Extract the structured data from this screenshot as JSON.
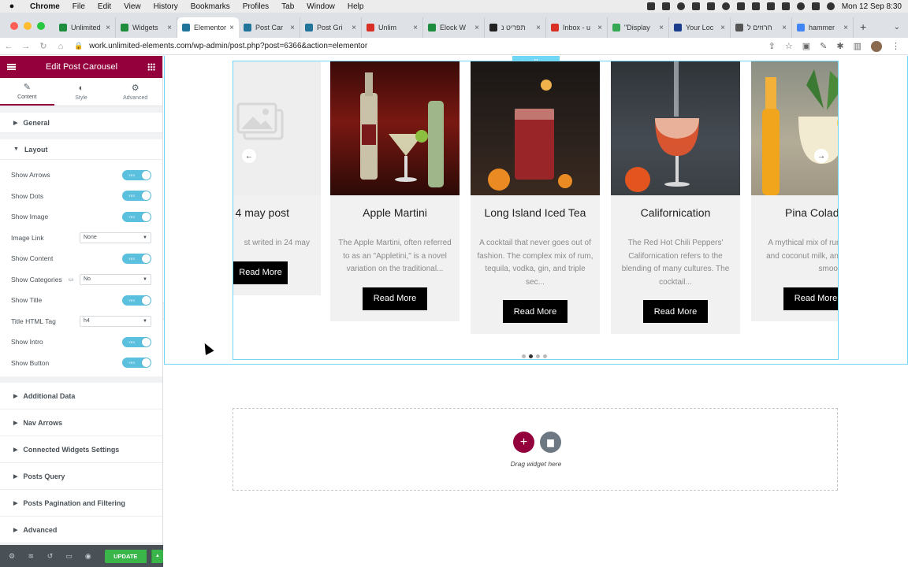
{
  "menubar": {
    "app": "Chrome",
    "items": [
      "File",
      "Edit",
      "View",
      "History",
      "Bookmarks",
      "Profiles",
      "Tab",
      "Window",
      "Help"
    ],
    "clock": "Mon 12 Sep  8:30"
  },
  "tabs": [
    {
      "title": "Unlimited",
      "color": "#1e8e3e"
    },
    {
      "title": "Widgets",
      "color": "#1e8e3e"
    },
    {
      "title": "Elementor",
      "color": "#21759b"
    },
    {
      "title": "Post Car",
      "color": "#21759b"
    },
    {
      "title": "Post Gri",
      "color": "#21759b"
    },
    {
      "title": "Unlim",
      "color": "#d93025"
    },
    {
      "title": "Elock W",
      "color": "#1e8e3e"
    },
    {
      "title": "תפריט נ",
      "color": "#222222"
    },
    {
      "title": "Inbox - u",
      "color": "#d93025"
    },
    {
      "title": "\"Display",
      "color": "#34a853"
    },
    {
      "title": "Your Loc",
      "color": "#1a3e8c"
    },
    {
      "title": "חרוזים ל",
      "color": "#555555"
    },
    {
      "title": "hammer",
      "color": "#4285f4"
    }
  ],
  "address": {
    "url": "work.unlimited-elements.com/wp-admin/post.php?post=6366&action=elementor"
  },
  "panel": {
    "title": "Edit Post Carousel",
    "tabs": [
      {
        "label": "Content",
        "glyph": "✎"
      },
      {
        "label": "Style",
        "glyph": "◐"
      },
      {
        "label": "Advanced",
        "glyph": "⚙"
      }
    ],
    "section_general": "General",
    "section_layout": "Layout",
    "toggle_text": "YES",
    "controls": {
      "show_arrows": "Show Arrows",
      "show_dots": "Show Dots",
      "show_image": "Show Image",
      "image_link": "Image Link",
      "image_link_value": "None",
      "show_content": "Show Content",
      "show_categories": "Show Categories",
      "show_categories_value": "No",
      "show_title": "Show Title",
      "title_tag": "Title HTML Tag",
      "title_tag_value": "h4",
      "show_intro": "Show Intro",
      "show_button": "Show Button"
    },
    "sections": [
      "Additional Data",
      "Nav Arrows",
      "Connected Widgets Settings",
      "Posts Query",
      "Posts Pagination and Filtering",
      "Advanced"
    ],
    "update_label": "UPDATE"
  },
  "carousel": {
    "cards": [
      {
        "title": "4 may post",
        "intro": "st writed in 24 may",
        "button": "Read More"
      },
      {
        "title": "Apple Martini",
        "intro": "The Apple Martini, often referred to as an \"Appletini,\" is a novel variation on the traditional...",
        "button": "Read More"
      },
      {
        "title": "Long Island Iced Tea",
        "intro": "A cocktail that never goes out of fashion. The complex mix of rum, tequila, vodka, gin, and triple sec...",
        "button": "Read More"
      },
      {
        "title": "Californication",
        "intro": "The Red Hot Chili Peppers' Californication refers to the blending of many cultures. The cocktail...",
        "button": "Read More"
      },
      {
        "title": "Pina Colada",
        "intro": "A mythical mix of rum, cream, pineapple and coconut milk, and nectar. More like a smoothie...",
        "button": "Read More"
      }
    ],
    "dots_active": 2
  },
  "dropzone": {
    "text": "Drag widget here"
  },
  "colors": {
    "elementor_brand": "#93003c",
    "toggle_on": "#5bc0de",
    "update_green": "#39b54a",
    "outline": "#71d7f7"
  }
}
